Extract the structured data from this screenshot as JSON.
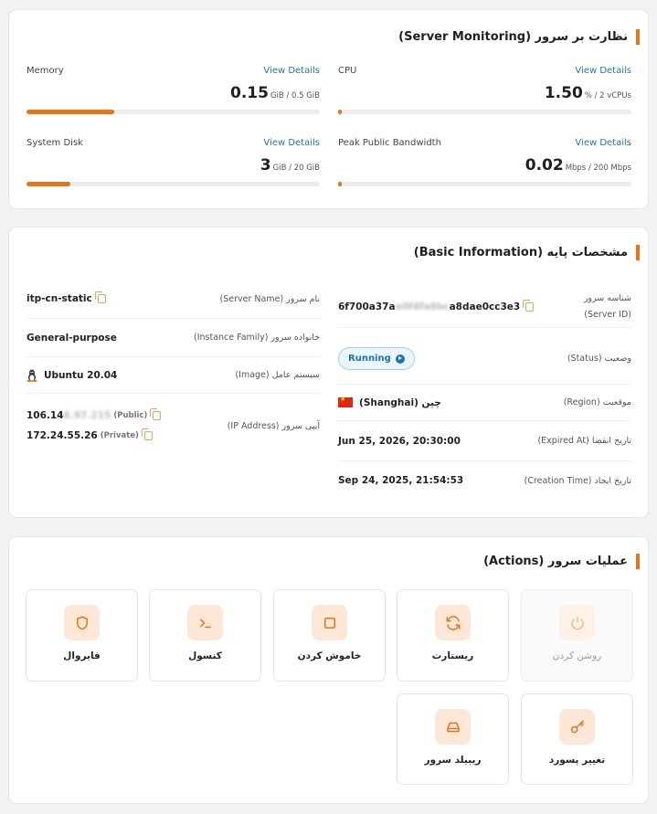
{
  "monitoring": {
    "title": "نظارت بر سرور (Server Monitoring)",
    "metrics": [
      {
        "label": "CPU",
        "link": "View Details",
        "value": "1.50",
        "unit": "% / 2 vCPUs",
        "fraction": 0.01
      },
      {
        "label": "Memory",
        "link": "View Details",
        "value": "0.15",
        "unit": "GiB / 0.5 GiB",
        "fraction": 0.3
      },
      {
        "label": "Peak Public Bandwidth",
        "link": "View Details",
        "value": "0.02",
        "unit": "Mbps / 200 Mbps",
        "fraction": 0.0
      },
      {
        "label": "System Disk",
        "link": "View Details",
        "value": "3",
        "unit": "GiB / 20 GiB",
        "fraction": 0.15
      }
    ]
  },
  "basic": {
    "title": "مشخصات پایه (Basic Information)",
    "server_id_label": "شناسه سرور (Server ID)",
    "server_id_start": "6f700a37a",
    "server_id_hidden": "e0f4fa8bc",
    "server_id_end": "a8dae0cc3e3",
    "status_label": "وضعیت (Status)",
    "status_value": "Running",
    "region_label": "موقعیت (Region)",
    "region_value": "چین (Shanghai)",
    "expired_label": "تاریخ انقضا (Expired At)",
    "expired_value": "Jun 25, 2026, 20:30:00",
    "created_label": "تاریخ ایجاد (Creation Time)",
    "created_value": "Sep 24, 2025, 21:54:53",
    "server_name_label": "نام سرور (Server Name)",
    "server_name_value": "itp-cn-static",
    "family_label": "خانواده سرور (Instance Family)",
    "family_value": "General-purpose",
    "image_label": "سیستم عامل (Image)",
    "image_value": "Ubuntu 20.04",
    "ip_label": "آیپی سرور (IP Address)",
    "public_ip_start": "106.14",
    "public_ip_hidden": "6.97.215",
    "public_tag": "(Public)",
    "private_ip": "172.24.55.26",
    "private_tag": "(Private)"
  },
  "actions": {
    "title": "عملیات سرور (Actions)",
    "items": [
      {
        "label": "روشن کردن",
        "icon": "power-icon",
        "enabled": false
      },
      {
        "label": "ریستارت",
        "icon": "restart-icon",
        "enabled": true
      },
      {
        "label": "خاموش کردن",
        "icon": "stop-icon",
        "enabled": true
      },
      {
        "label": "کنسول",
        "icon": "terminal-icon",
        "enabled": true
      },
      {
        "label": "فایروال",
        "icon": "shield-icon",
        "enabled": true
      },
      {
        "label": "تغییر پسورد",
        "icon": "key-icon",
        "enabled": true
      },
      {
        "label": "ریبیلد سرور",
        "icon": "disk-icon",
        "enabled": true
      }
    ]
  },
  "colors": {
    "accent": "#e8741a",
    "link": "#2a6fb5",
    "status": "#1b74b8"
  }
}
